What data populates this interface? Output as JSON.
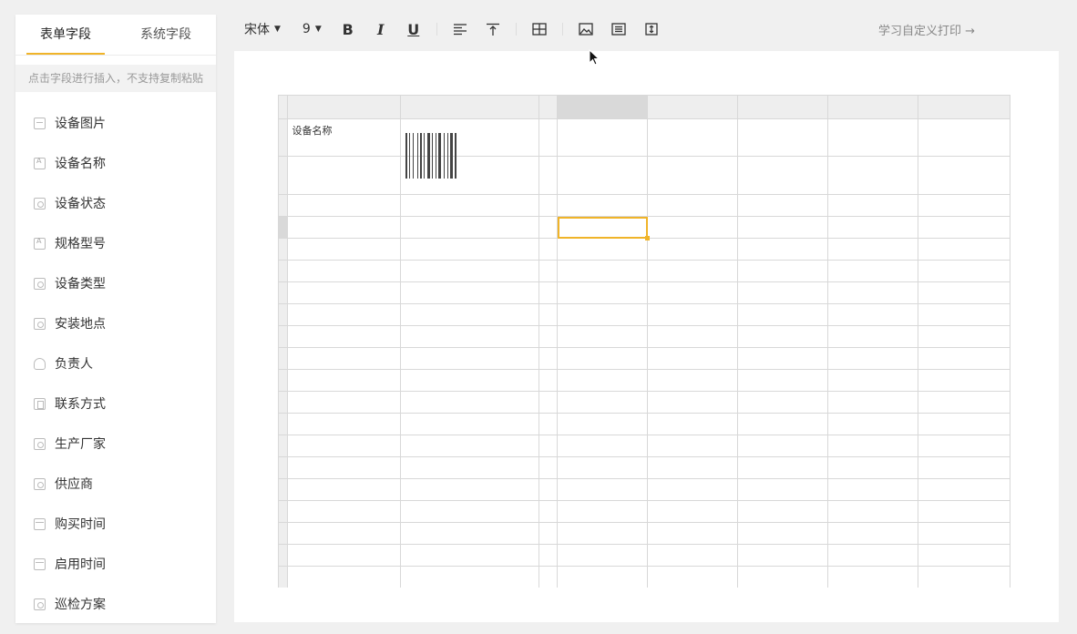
{
  "sidebar": {
    "tabs": [
      {
        "label": "表单字段",
        "active": true
      },
      {
        "label": "系统字段",
        "active": false
      }
    ],
    "hint": "点击字段进行插入，不支持复制粘贴",
    "fields": [
      {
        "label": "设备图片",
        "icon": "image-icon"
      },
      {
        "label": "设备名称",
        "icon": "text-field-icon"
      },
      {
        "label": "设备状态",
        "icon": "select-icon"
      },
      {
        "label": "规格型号",
        "icon": "text-field-icon"
      },
      {
        "label": "设备类型",
        "icon": "select-icon"
      },
      {
        "label": "安装地点",
        "icon": "select-icon"
      },
      {
        "label": "负责人",
        "icon": "user-icon"
      },
      {
        "label": "联系方式",
        "icon": "phone-icon"
      },
      {
        "label": "生产厂家",
        "icon": "select-icon"
      },
      {
        "label": "供应商",
        "icon": "select-icon"
      },
      {
        "label": "购买时间",
        "icon": "calendar-icon"
      },
      {
        "label": "启用时间",
        "icon": "calendar-icon"
      },
      {
        "label": "巡检方案",
        "icon": "select-icon"
      }
    ]
  },
  "toolbar": {
    "font_family": "宋体",
    "font_size": "9",
    "bold": "B",
    "italic": "I",
    "underline": "U",
    "learn_link": "学习自定义打印 →"
  },
  "sheet": {
    "cells": [
      {
        "row": 1,
        "col": 1,
        "text": "设备名称"
      }
    ],
    "selected_cell": {
      "row": 4,
      "col": 3
    },
    "barcode_cell": {
      "row": 1,
      "col": 2
    }
  },
  "colors": {
    "accent": "#f0b429",
    "header_bg": "#eeeeee",
    "grid_line": "#d8d8d8"
  }
}
